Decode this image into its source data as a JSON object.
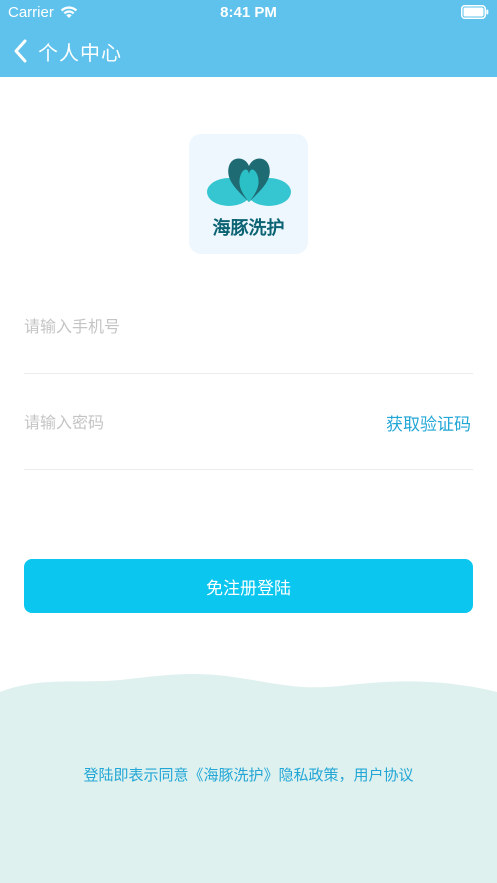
{
  "status_bar": {
    "carrier": "Carrier",
    "time": "8:41 PM"
  },
  "nav": {
    "title": "个人中心"
  },
  "logo": {
    "text": "海豚洗护",
    "colors": {
      "heart_dark": "#1f6b73",
      "heart_teal": "#2bc0c6",
      "cloud": "#35c6d1"
    }
  },
  "form": {
    "phone_placeholder": "请输入手机号",
    "code_placeholder": "请输入密码",
    "get_code_label": "获取验证码",
    "login_label": "免注册登陆"
  },
  "footer": {
    "agreement_prefix": "登陆即表示同意《海豚洗护》",
    "privacy_link": "隐私政策",
    "separator": "，",
    "user_agreement_link": "用户协议"
  },
  "colors": {
    "header_bg": "#5ec2ec",
    "button_bg": "#0bc7ef",
    "accent_text": "#22a6d6",
    "wave_bg": "#dff1ee"
  }
}
